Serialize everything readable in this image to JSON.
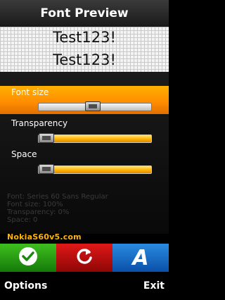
{
  "title": "Font Preview",
  "preview": {
    "line1": "Test123!",
    "line2": "Test123!"
  },
  "settings": {
    "font_size": {
      "label": "Font size",
      "level": 0.48
    },
    "transparency": {
      "label": "Transparency",
      "level": 0.0
    },
    "space": {
      "label": "Space",
      "level": 0.0
    }
  },
  "info": {
    "font": "Font: Series 60 Sans Regular",
    "font_size": "Font size: 100%",
    "transparency": "Transparency: 0%",
    "space": "Space: 0"
  },
  "watermark": "NokiaS60v5.com",
  "buttons": {
    "accept": {
      "icon": "checkmark-icon",
      "color": "#2a9a12"
    },
    "reset": {
      "icon": "refresh-icon",
      "color": "#c41010"
    },
    "font": {
      "icon": "font-a-icon",
      "glyph": "A",
      "color": "#1a6fc8"
    }
  },
  "softkeys": {
    "left": "Options",
    "right": "Exit"
  },
  "colors": {
    "accent": "#ff9a00",
    "background": "#000000"
  }
}
